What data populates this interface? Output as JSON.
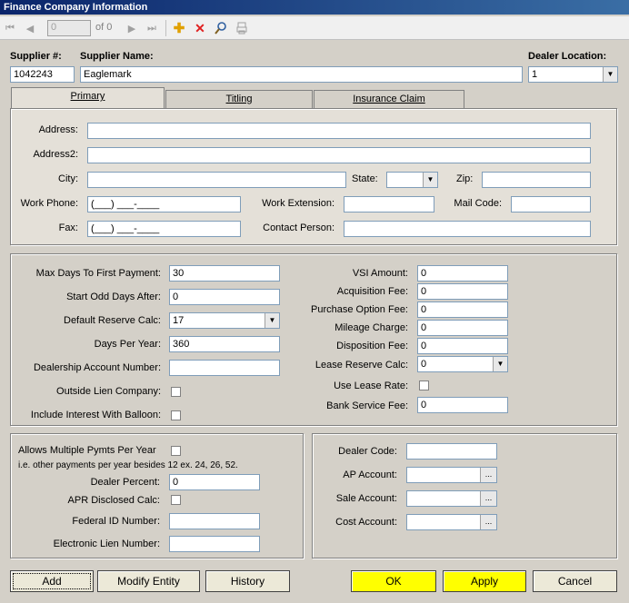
{
  "window": {
    "title": "Finance Company Information"
  },
  "nav": {
    "record": "0",
    "of_label": "of 0"
  },
  "header": {
    "supplier_num_label": "Supplier #:",
    "supplier_num": "1042243",
    "supplier_name_label": "Supplier Name:",
    "supplier_name": "Eaglemark",
    "dealer_location_label": "Dealer Location:",
    "dealer_location": "1"
  },
  "tabs": [
    "Primary",
    "Titling",
    "Insurance Claim"
  ],
  "primary": {
    "address_label": "Address:",
    "address2_label": "Address2:",
    "city_label": "City:",
    "state_label": "State:",
    "zip_label": "Zip:",
    "work_phone_label": "Work Phone:",
    "work_phone": "(___) ___-____",
    "work_ext_label": "Work Extension:",
    "mail_code_label": "Mail Code:",
    "fax_label": "Fax:",
    "fax": "(___) ___-____",
    "contact_label": "Contact Person:"
  },
  "settings": {
    "max_days_label": "Max Days To First Payment:",
    "max_days": "30",
    "start_odd_label": "Start Odd Days After:",
    "start_odd": "0",
    "default_reserve_label": "Default Reserve Calc:",
    "default_reserve": "17",
    "days_per_year_label": "Days Per Year:",
    "days_per_year": "360",
    "dealership_acct_label": "Dealership Account Number:",
    "outside_lien_label": "Outside Lien Company:",
    "include_interest_label": "Include Interest With Balloon:",
    "vsi_label": "VSI Amount:",
    "vsi": "0",
    "acq_fee_label": "Acquisition Fee:",
    "acq_fee": "0",
    "purchase_opt_label": "Purchase Option Fee:",
    "purchase_opt": "0",
    "mileage_label": "Mileage Charge:",
    "mileage": "0",
    "disposition_label": "Disposition Fee:",
    "disposition": "0",
    "lease_reserve_label": "Lease Reserve Calc:",
    "lease_reserve": "0",
    "use_lease_rate_label": "Use Lease Rate:",
    "bank_service_label": "Bank Service Fee:",
    "bank_service": "0"
  },
  "bottom_left": {
    "multi_pymts_label": "Allows Multiple Pymts Per Year",
    "multi_pymts_hint": "i.e. other payments per year besides 12 ex. 24, 26, 52.",
    "dealer_percent_label": "Dealer Percent:",
    "dealer_percent": "0",
    "apr_label": "APR Disclosed Calc:",
    "federal_id_label": "Federal ID Number:",
    "elec_lien_label": "Electronic Lien Number:"
  },
  "bottom_right": {
    "dealer_code_label": "Dealer Code:",
    "ap_account_label": "AP Account:",
    "sale_account_label": "Sale Account:",
    "cost_account_label": "Cost Account:",
    "ellipsis": "..."
  },
  "buttons": {
    "add": "Add",
    "modify": "Modify Entity",
    "history": "History",
    "ok": "OK",
    "apply": "Apply",
    "cancel": "Cancel"
  },
  "colors": {
    "title_bar": "#0a246a",
    "highlight_button": "#ffff00"
  },
  "icons": [
    "first-icon",
    "prev-icon",
    "next-icon",
    "last-icon",
    "add-icon",
    "delete-icon",
    "search-icon",
    "print-icon"
  ]
}
